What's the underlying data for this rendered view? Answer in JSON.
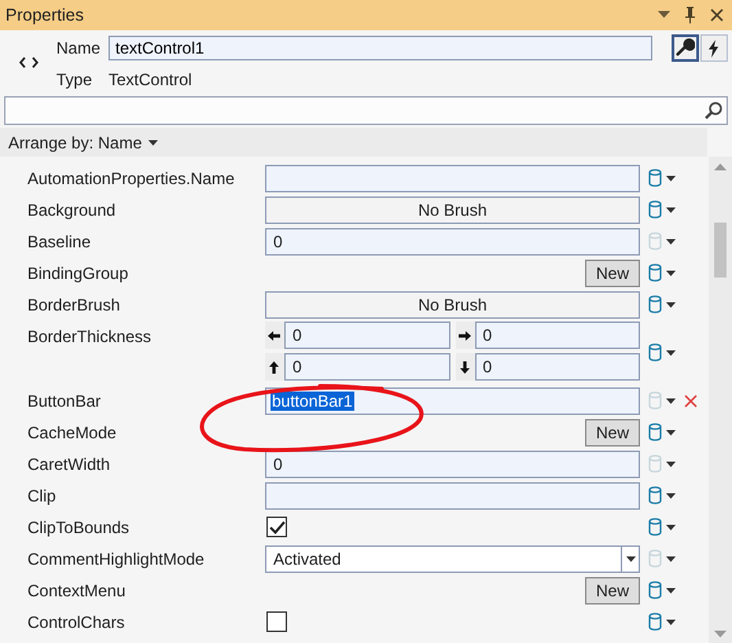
{
  "window": {
    "title": "Properties"
  },
  "header": {
    "name_label": "Name",
    "name_value": "textControl1",
    "type_label": "Type",
    "type_value": "TextControl",
    "tabs": [
      {
        "kind": "properties",
        "selected": true
      },
      {
        "kind": "events",
        "selected": false
      }
    ]
  },
  "arrange": {
    "label": "Arrange by: Name"
  },
  "properties": [
    {
      "name": "AutomationProperties.Name",
      "kind": "text",
      "marker_active": true
    },
    {
      "name": "Background",
      "kind": "brush",
      "value": "No Brush",
      "marker_active": true
    },
    {
      "name": "Baseline",
      "kind": "text",
      "value": "0",
      "marker_active": false
    },
    {
      "name": "BindingGroup",
      "kind": "new",
      "value": "New",
      "marker_active": true
    },
    {
      "name": "BorderBrush",
      "kind": "brush",
      "value": "No Brush",
      "marker_active": true
    },
    {
      "name": "BorderThickness",
      "kind": "thickness",
      "marker_active": true,
      "sides": [
        {
          "kind": "left",
          "value": "0"
        },
        {
          "kind": "right",
          "value": "0"
        },
        {
          "kind": "top",
          "value": "0"
        },
        {
          "kind": "bottom",
          "value": "0"
        }
      ]
    },
    {
      "name": "ButtonBar",
      "kind": "text",
      "value": "buttonBar1",
      "selected": true,
      "clearable": true,
      "marker_active": false
    },
    {
      "name": "CacheMode",
      "kind": "new",
      "value": "New",
      "marker_active": true
    },
    {
      "name": "CaretWidth",
      "kind": "text",
      "value": "0",
      "marker_active": false
    },
    {
      "name": "Clip",
      "kind": "text",
      "marker_active": true
    },
    {
      "name": "ClipToBounds",
      "kind": "checkbox",
      "checked": true,
      "marker_active": true
    },
    {
      "name": "CommentHighlightMode",
      "kind": "combo",
      "value": "Activated",
      "marker_active": false
    },
    {
      "name": "ContextMenu",
      "kind": "new",
      "value": "New",
      "marker_active": true
    },
    {
      "name": "ControlChars",
      "kind": "checkbox",
      "checked": false,
      "marker_active": true
    }
  ],
  "annotation": {
    "kind": "ellipse"
  }
}
